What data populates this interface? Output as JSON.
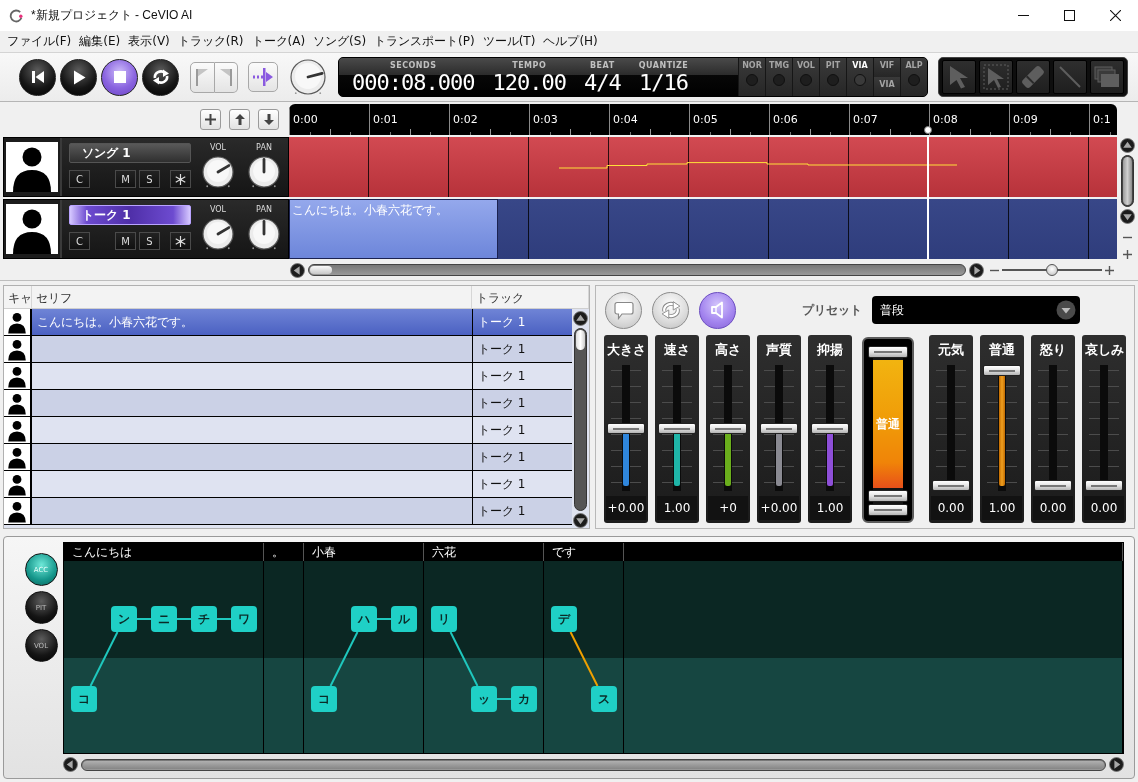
{
  "window": {
    "title": "*新規プロジェクト - CeVIO AI"
  },
  "menu": [
    "ファイル(F)",
    "編集(E)",
    "表示(V)",
    "トラック(R)",
    "トーク(A)",
    "ソング(S)",
    "トランスポート(P)",
    "ツール(T)",
    "ヘルプ(H)"
  ],
  "transport": [
    {
      "kind": "rewind",
      "active": false
    },
    {
      "kind": "play",
      "active": false
    },
    {
      "kind": "stop",
      "active": true
    },
    {
      "kind": "loop",
      "active": false
    }
  ],
  "master_knob": {
    "level": 0.78
  },
  "display": [
    {
      "label": "SECONDS",
      "value": "000:08.000"
    },
    {
      "label": "TEMPO",
      "value": "120.00"
    },
    {
      "label": "BEAT",
      "value": "4/4"
    },
    {
      "label": "QUANTIZE",
      "value": "1/16"
    }
  ],
  "parameter_buttons": [
    {
      "kind": "led",
      "label": "NOR",
      "enabled": false
    },
    {
      "kind": "led",
      "label": "TMG",
      "enabled": false
    },
    {
      "kind": "led",
      "label": "VOL",
      "enabled": false
    },
    {
      "kind": "led",
      "label": "PIT",
      "enabled": false
    },
    {
      "kind": "led",
      "label": "VIA",
      "enabled": true
    },
    {
      "kind": "split",
      "label": "VIF",
      "sub_label": "VIA",
      "enabled": false
    },
    {
      "kind": "led",
      "label": "ALP",
      "enabled": false
    }
  ],
  "tools": [
    {
      "kind": "pointer"
    },
    {
      "kind": "select"
    },
    {
      "kind": "eraser"
    },
    {
      "kind": "line"
    },
    {
      "kind": "layers"
    }
  ],
  "timeline": {
    "ticks": [
      "0:00",
      "0:01",
      "0:02",
      "0:03",
      "0:04",
      "0:05",
      "0:06",
      "0:07",
      "0:08",
      "0:09",
      "0:1"
    ],
    "playhead": {
      "level": 0.772
    }
  },
  "tracks": [
    {
      "kind": "song",
      "name": "ソング 1",
      "selected": false,
      "buttons": [
        "C",
        "M",
        "S"
      ],
      "knobs": [
        {
          "label": "VOL",
          "level": 0.72
        },
        {
          "label": "PAN",
          "level": 0.5
        }
      ]
    },
    {
      "kind": "talk",
      "name": "トーク 1",
      "selected": true,
      "buttons": [
        "C",
        "M",
        "S"
      ],
      "knobs": [
        {
          "label": "VOL",
          "level": 0.72
        },
        {
          "label": "PAN",
          "level": 0.5
        }
      ],
      "clip": {
        "text": "こんにちは。小春六花です。",
        "level": 0.252
      }
    }
  ],
  "zoom_slider": {
    "level": 0.5
  },
  "table": {
    "columns": [
      "キャ",
      "セリフ",
      "トラック"
    ],
    "rows": [
      {
        "text": "こんにちは。小春六花です。",
        "track": "トーク 1",
        "selected": true
      },
      {
        "track": "トーク 1",
        "selected": false
      },
      {
        "track": "トーク 1",
        "selected": false
      },
      {
        "track": "トーク 1",
        "selected": false
      },
      {
        "track": "トーク 1",
        "selected": false
      },
      {
        "track": "トーク 1",
        "selected": false
      },
      {
        "track": "トーク 1",
        "selected": false
      },
      {
        "track": "トーク 1",
        "selected": false
      }
    ]
  },
  "mode_buttons": [
    {
      "kind": "bubble",
      "selected": false
    },
    {
      "kind": "loop",
      "selected": false
    },
    {
      "kind": "speaker",
      "selected": true
    }
  ],
  "preset": {
    "label": "プリセット",
    "value": "普段"
  },
  "voice_params": [
    {
      "label": "大きさ",
      "value": "+0.00",
      "level": 0.5,
      "color": "#2f86dc"
    },
    {
      "label": "速さ",
      "value": "1.00",
      "level": 0.5,
      "color": "#1fb5a8"
    },
    {
      "label": "高さ",
      "value": "+0",
      "level": 0.5,
      "color": "#6aae1c"
    },
    {
      "label": "声質",
      "value": "+0.00",
      "level": 0.5,
      "color": "#8a8a92"
    },
    {
      "label": "抑揚",
      "value": "1.00",
      "level": 0.5,
      "color": "#8e4fd8"
    }
  ],
  "emotion_mix": {
    "label": "普通",
    "level": 1
  },
  "emotions": [
    {
      "label": "元気",
      "value": "0.00",
      "level": 0
    },
    {
      "label": "普通",
      "value": "1.00",
      "level": 1
    },
    {
      "label": "怒り",
      "value": "0.00",
      "level": 0
    },
    {
      "label": "哀しみ",
      "value": "0.00",
      "level": 0
    }
  ],
  "editor_modes": [
    {
      "label": "ACC",
      "selected": true
    },
    {
      "label": "PIT",
      "selected": false
    },
    {
      "label": "VOL",
      "selected": false
    }
  ],
  "accent_words": [
    {
      "text": "こんにちは",
      "color": "#1fc8be",
      "morae": [
        {
          "text": "コ",
          "high": false
        },
        {
          "text": "ン",
          "high": true
        },
        {
          "text": "ニ",
          "high": true
        },
        {
          "text": "チ",
          "high": true
        },
        {
          "text": "ワ",
          "high": true
        }
      ]
    },
    {
      "text": "。"
    },
    {
      "text": "小春",
      "color": "#1fc8be",
      "morae": [
        {
          "text": "コ",
          "high": false
        },
        {
          "text": "ハ",
          "high": true
        },
        {
          "text": "ル",
          "high": true
        }
      ]
    },
    {
      "text": "六花",
      "color": "#1fc8be",
      "morae": [
        {
          "text": "リ",
          "high": true
        },
        {
          "text": "ッ",
          "high": false
        },
        {
          "text": "カ",
          "high": false
        }
      ]
    },
    {
      "text": "です",
      "color": "#f0a000",
      "morae": [
        {
          "text": "デ",
          "high": true
        },
        {
          "text": "ス",
          "high": false
        }
      ]
    }
  ]
}
